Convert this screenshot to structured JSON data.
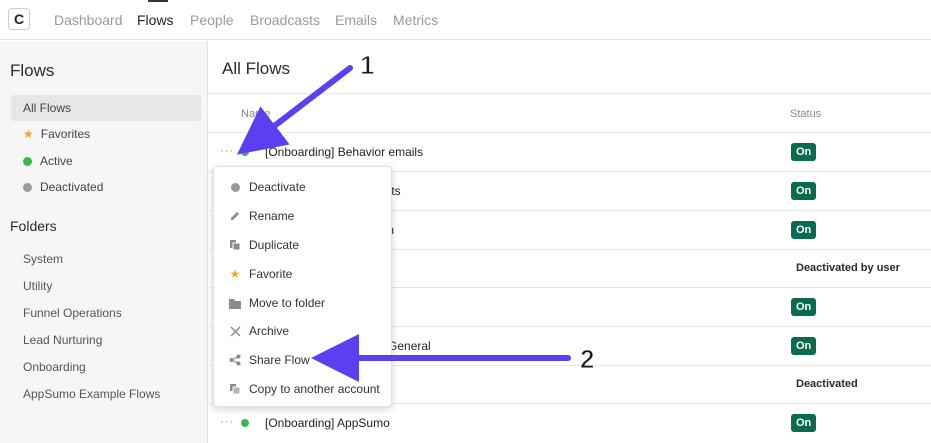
{
  "topnav": {
    "logo": "C",
    "items": [
      {
        "label": "Dashboard",
        "active": false
      },
      {
        "label": "Flows",
        "active": true
      },
      {
        "label": "People",
        "active": false
      },
      {
        "label": "Broadcasts",
        "active": false
      },
      {
        "label": "Emails",
        "active": false
      },
      {
        "label": "Metrics",
        "active": false
      }
    ]
  },
  "sidebar": {
    "title": "Flows",
    "filters": [
      {
        "label": "All Flows",
        "icon": "none"
      },
      {
        "label": "Favorites",
        "icon": "star-icon"
      },
      {
        "label": "Active",
        "icon": "green-dot-icon"
      },
      {
        "label": "Deactivated",
        "icon": "gray-dot-icon"
      }
    ],
    "folders_title": "Folders",
    "folders": [
      "System",
      "Utility",
      "Funnel Operations",
      "Lead Nurturing",
      "Onboarding",
      "AppSumo Example Flows"
    ]
  },
  "main": {
    "title": "All Flows",
    "columns": {
      "name": "Name",
      "status": "Status"
    },
    "rows": [
      {
        "name": "[Onboarding] Behavior emails",
        "status": "On",
        "dot": "green"
      },
      {
        "name": "Events",
        "status": "On",
        "dot": "green"
      },
      {
        "name": "reach",
        "status": "On",
        "dot": "green"
      },
      {
        "name": "",
        "status": "Deactivated by user",
        "dot": "gray"
      },
      {
        "name": "",
        "status": "On",
        "dot": "green"
      },
      {
        "name": "ed - General",
        "status": "On",
        "dot": "green"
      },
      {
        "name": "",
        "status": "Deactivated",
        "dot": "gray"
      },
      {
        "name": "[Onboarding] AppSumo",
        "status": "On",
        "dot": "green"
      }
    ],
    "row_more": "···"
  },
  "context_menu": {
    "items": [
      {
        "label": "Deactivate",
        "icon": "gray-dot-icon"
      },
      {
        "label": "Rename",
        "icon": "pencil-icon"
      },
      {
        "label": "Duplicate",
        "icon": "duplicate-icon"
      },
      {
        "label": "Favorite",
        "icon": "star-icon"
      },
      {
        "label": "Move to folder",
        "icon": "folder-icon"
      },
      {
        "label": "Archive",
        "icon": "x-icon"
      },
      {
        "label": "Share Flow",
        "icon": "share-icon"
      },
      {
        "label": "Copy to another account",
        "icon": "copy-icon"
      }
    ]
  },
  "annotations": {
    "one": "1",
    "two": "2"
  },
  "colors": {
    "accent_green": "#0b6b4e",
    "dot_green": "#3cb84a",
    "dot_gray": "#9a9a9a",
    "arrow": "#5b3ff0",
    "star": "#f5a623"
  }
}
